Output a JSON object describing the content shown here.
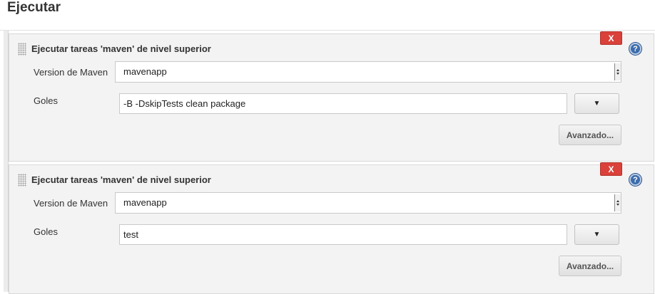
{
  "section": {
    "title": "Ejecutar"
  },
  "steps": [
    {
      "title": "Ejecutar tareas 'maven' de nivel superior",
      "delete_label": "X",
      "help_label": "?",
      "maven_version_label": "Version de Maven",
      "maven_version_value": "mavenapp",
      "goals_label": "Goles",
      "goals_value": "-B -DskipTests clean package",
      "goals_dropdown_label": "▼",
      "advanced_label": "Avanzado..."
    },
    {
      "title": "Ejecutar tareas 'maven' de nivel superior",
      "delete_label": "X",
      "help_label": "?",
      "maven_version_label": "Version de Maven",
      "maven_version_value": "mavenapp",
      "goals_label": "Goles",
      "goals_value": "test",
      "goals_dropdown_label": "▼",
      "advanced_label": "Avanzado..."
    }
  ],
  "colors": {
    "delete_button": "#d9413a",
    "help_icon": "#3c6cab",
    "panel_background": "#f3f3f3"
  }
}
